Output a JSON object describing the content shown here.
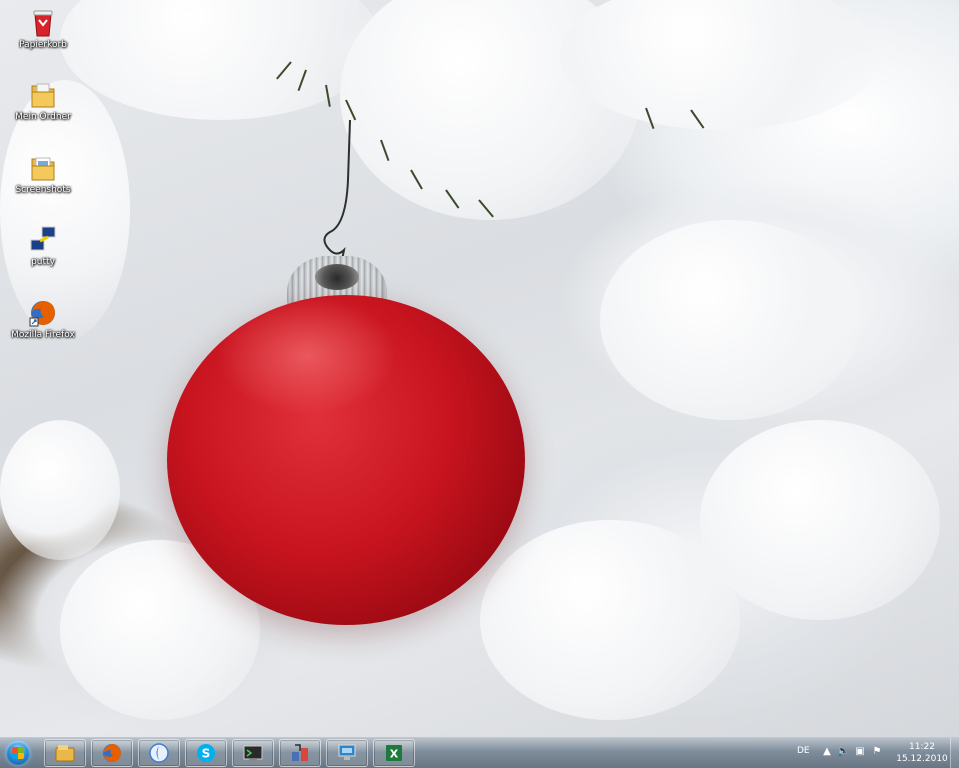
{
  "desktop": {
    "icons": [
      {
        "label": "Papierkorb",
        "icon": "recycle-bin-icon"
      },
      {
        "label": "Mein Ordner",
        "icon": "folder-icon"
      },
      {
        "label": "Screenshots",
        "icon": "folder-icon"
      },
      {
        "label": "putty",
        "icon": "putty-icon"
      },
      {
        "label": "Mozilla Firefox",
        "icon": "firefox-icon"
      }
    ]
  },
  "taskbar": {
    "pinned": [
      {
        "name": "explorer",
        "icon": "folder-icon",
        "color": "#e8b84a"
      },
      {
        "name": "firefox",
        "icon": "firefox-icon",
        "color": "#e66000"
      },
      {
        "name": "app-blue-circle",
        "icon": "blue-circle-icon",
        "color": "#3b7fd1"
      },
      {
        "name": "skype",
        "icon": "skype-icon",
        "color": "#00aff0"
      },
      {
        "name": "terminal",
        "icon": "terminal-icon",
        "color": "#3f8f3a"
      },
      {
        "name": "tool",
        "icon": "tool-icon",
        "color": "#4a6fb5"
      },
      {
        "name": "remote-desktop",
        "icon": "remote-desktop-icon",
        "color": "#2e86c9"
      },
      {
        "name": "excel",
        "icon": "excel-icon",
        "color": "#1e7a3c"
      }
    ],
    "tray": {
      "language": "DE",
      "time": "11:22",
      "date": "15.12.2010"
    }
  }
}
